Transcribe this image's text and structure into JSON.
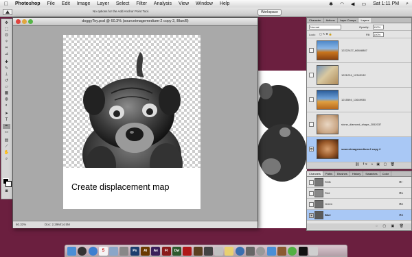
{
  "menubar": {
    "app": "Photoshop",
    "items": [
      "File",
      "Edit",
      "Image",
      "Layer",
      "Select",
      "Filter",
      "Analysis",
      "View",
      "Window",
      "Help"
    ],
    "clock": "Sat 1:11 PM"
  },
  "optionsbar": {
    "hint": "No options for the Add Anchor Point Tool.",
    "workspace": "Workspace"
  },
  "document": {
    "title": "doggyToy.psd @ 60.3% (sourceimagemedium-2 copy 2, Blue/8)",
    "caption": "Create displacement map",
    "zoom": "60.33%",
    "docsize": "Doc: 2.29M/14.5M"
  },
  "layers_panel": {
    "tabs": [
      "Character",
      "Actions",
      "Layer Comps",
      "Layers"
    ],
    "blend_mode": "Normal",
    "opacity_label": "Opacity:",
    "opacity": "100%",
    "lock_label": "Lock:",
    "fill_label": "Fill:",
    "fill": "100%",
    "layers": [
      {
        "name": "12222427_66848887"
      },
      {
        "name": "1221224_12343132"
      },
      {
        "name": "1215594_13649935"
      },
      {
        "name": "stone_diamond_shape_2052037"
      },
      {
        "name": "sourceimagemedium-2 copy 2",
        "selected": true
      }
    ]
  },
  "channels_panel": {
    "tabs": [
      "Channels",
      "Paths",
      "Brushes",
      "History",
      "Swatches",
      "Color"
    ],
    "channels": [
      {
        "name": "RGB",
        "shortcut": "⌘~"
      },
      {
        "name": "Red",
        "shortcut": "⌘1"
      },
      {
        "name": "Green",
        "shortcut": "⌘2"
      },
      {
        "name": "Blue",
        "shortcut": "⌘3",
        "selected": true
      }
    ]
  },
  "dock": {
    "apps": [
      "Finder",
      "Dashboard",
      "Safari",
      "iCal",
      "Preview",
      "System",
      "Ps",
      "Ai",
      "Ae",
      "Fl",
      "Dw",
      "Acrobat",
      "Bridge",
      "Camera",
      "Sound",
      "Notes",
      "Browser",
      "Calc",
      "Time",
      "Mail",
      "Book",
      "Chat",
      "Terminal",
      "Trash"
    ]
  },
  "colors": {
    "desktop": "#6b1f3f",
    "selection": "#a9c8f5"
  }
}
